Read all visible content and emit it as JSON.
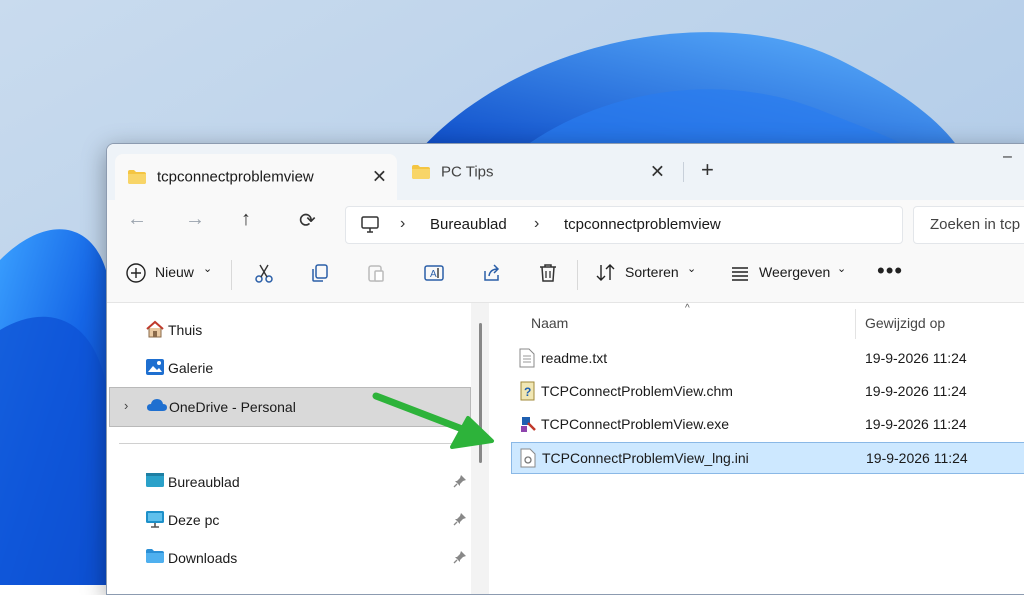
{
  "window": {
    "tabs": [
      {
        "label": "tcpconnectproblemview",
        "active": true
      },
      {
        "label": "PC Tips",
        "active": false
      }
    ],
    "new_tab_glyph": "+",
    "minimize_glyph": "–"
  },
  "nav": {
    "back_glyph": "←",
    "forward_glyph": "→",
    "up_glyph": "↑",
    "refresh_glyph": "⟳",
    "breadcrumbs": [
      "Bureaublad",
      "tcpconnectproblemview"
    ],
    "search_placeholder": "Zoeken in tcp"
  },
  "commandbar": {
    "new_label": "Nieuw",
    "sort_label": "Sorteren",
    "view_label": "Weergeven",
    "more_glyph": "•••"
  },
  "sidebar": {
    "items": [
      {
        "label": "Thuis",
        "icon": "home-icon"
      },
      {
        "label": "Galerie",
        "icon": "gallery-icon"
      },
      {
        "label": "OneDrive - Personal",
        "icon": "onedrive-icon",
        "selected": true
      },
      {
        "label": "Bureaublad",
        "icon": "desktop-icon",
        "pinned": true
      },
      {
        "label": "Deze pc",
        "icon": "pc-icon",
        "pinned": true
      },
      {
        "label": "Downloads",
        "icon": "downloads-icon",
        "pinned": true
      }
    ]
  },
  "files": {
    "columns": {
      "name": "Naam",
      "modified": "Gewijzigd op"
    },
    "rows": [
      {
        "name": "readme.txt",
        "modified": "19-9-2026 11:24",
        "icon": "text-file-icon"
      },
      {
        "name": "TCPConnectProblemView.chm",
        "modified": "19-9-2026 11:24",
        "icon": "help-file-icon"
      },
      {
        "name": "TCPConnectProblemView.exe",
        "modified": "19-9-2026 11:24",
        "icon": "exe-file-icon"
      },
      {
        "name": "TCPConnectProblemView_lng.ini",
        "modified": "19-9-2026 11:24",
        "icon": "ini-file-icon",
        "selected": true
      }
    ]
  },
  "colors": {
    "accent": "#0067c0",
    "selection": "#cde8ff",
    "annotation_arrow": "#2db33a",
    "folder": "#f4c542"
  }
}
